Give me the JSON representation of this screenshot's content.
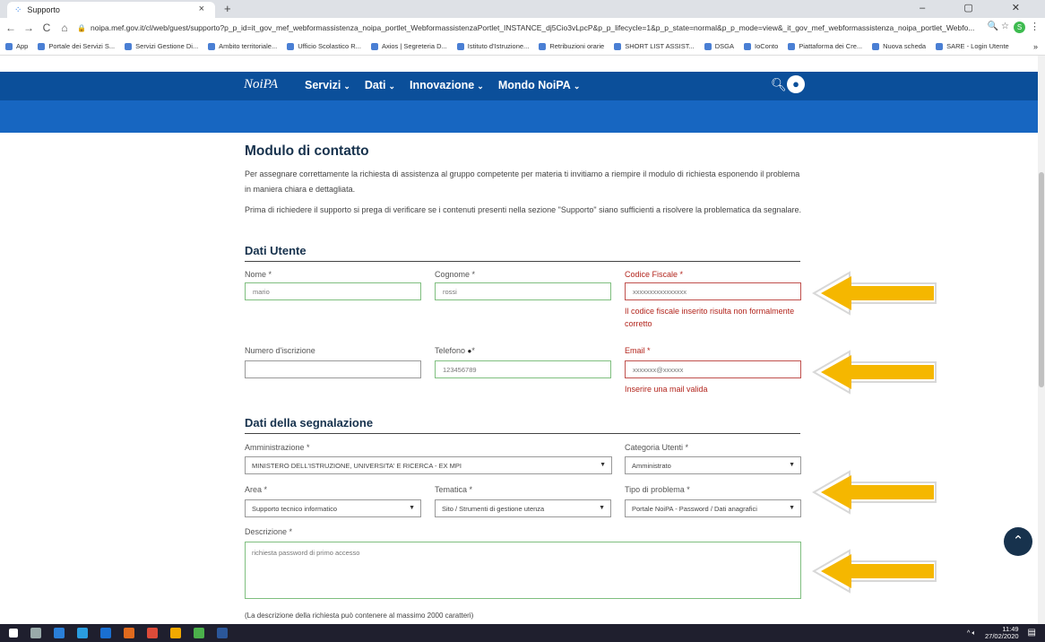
{
  "browser": {
    "tab_title": "Supporto",
    "tab_close": "×",
    "new_tab": "+",
    "window_controls": "– ▢ ✕",
    "url": "noipa.mef.gov.it/cl/web/guest/supporto?p_p_id=it_gov_mef_webformassistenza_noipa_portlet_WebformassistenzaPortlet_INSTANCE_dj5Cio3vLpcP&p_p_lifecycle=1&p_p_state=normal&p_p_mode=view&_it_gov_mef_webformassistenza_noipa_portlet_Webfo...",
    "profile_initial": "S",
    "bookmarks": [
      "App",
      "Portale dei Servizi S...",
      "Servizi Gestione Di...",
      "Ambito territoriale...",
      "Ufficio Scolastico R...",
      "Axios | Segreteria D...",
      "Istituto d'Istruzione...",
      "Retribuzioni orarie",
      "SHORT LIST ASSIST...",
      "DSGA",
      "IoConto",
      "Piattaforma dei Cre...",
      "Nuova scheda",
      "SARE - Login Utente"
    ],
    "bookmarks_more": "»"
  },
  "site": {
    "logo": "NoiPA",
    "menu": [
      "Servizi",
      "Dati",
      "Innovazione",
      "Mondo NoiPA"
    ]
  },
  "form": {
    "title": "Modulo di contatto",
    "intro1": "Per assegnare correttamente la richiesta di assistenza al gruppo competente per materia ti invitiamo a riempire il modulo di richiesta esponendo il problema in maniera chiara e dettagliata.",
    "intro2": "Prima di richiedere il supporto si prega di verificare se i contenuti presenti nella sezione \"Supporto\" siano sufficienti a risolvere la problematica da segnalare.",
    "section_user": "Dati Utente",
    "nome_label": "Nome *",
    "nome_value": "mario",
    "cognome_label": "Cognome *",
    "cognome_value": "rossi",
    "cf_label": "Codice Fiscale *",
    "cf_value": "xxxxxxxxxxxxxxxx",
    "cf_error": "Il codice fiscale inserito risulta non formalmente corretto",
    "iscrizione_label": "Numero d'iscrizione",
    "iscrizione_value": "",
    "telefono_label": "Telefono",
    "telefono_suffix": "*",
    "telefono_value": "123456789",
    "email_label": "Email *",
    "email_value": "xxxxxxx@xxxxxx",
    "email_error": "Inserire una mail valida",
    "section_report": "Dati della segnalazione",
    "amministrazione_label": "Amministrazione *",
    "amministrazione_value": "MINISTERO DELL'ISTRUZIONE, UNIVERSITA' E RICERCA - EX MPI",
    "categoria_label": "Categoria Utenti *",
    "categoria_value": "Amministrato",
    "area_label": "Area *",
    "area_value": "Supporto tecnico informatico",
    "tematica_label": "Tematica *",
    "tematica_value": "Sito / Strumenti di gestione utenza",
    "tipo_label": "Tipo di problema *",
    "tipo_value": "Portale NoiPA - Password / Dati anagrafici",
    "descrizione_label": "Descrizione *",
    "descrizione_value": "richiesta password di primo accesso",
    "descrizione_hint": "(La descrizione della richiesta può contenere al massimo 2000 caratteri)"
  },
  "taskbar": {
    "time": "11:49",
    "date": "27/02/2020"
  },
  "colors": {
    "nav_dark": "#0b4f9a",
    "nav_light": "#1766c1",
    "arrow": "#f5b700",
    "error": "#b3261e"
  }
}
